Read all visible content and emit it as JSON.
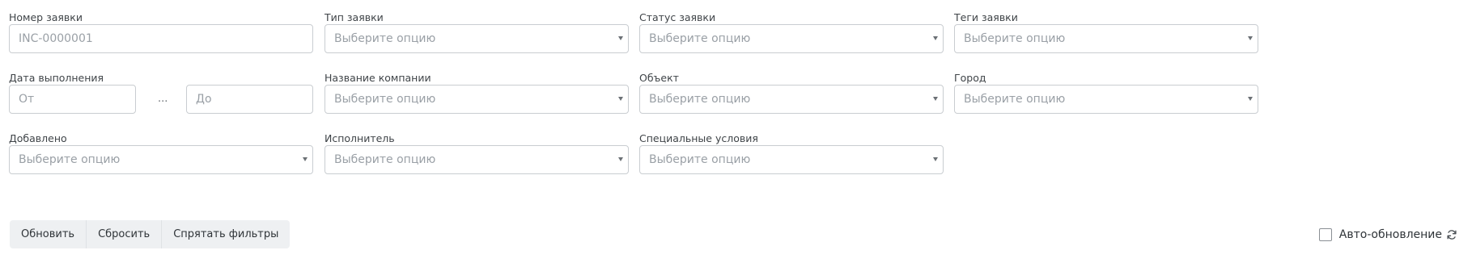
{
  "filters": {
    "request_number": {
      "label": "Номер заявки",
      "placeholder": "INC-0000001"
    },
    "request_type": {
      "label": "Тип заявки",
      "placeholder": "Выберите опцию"
    },
    "request_status": {
      "label": "Статус заявки",
      "placeholder": "Выберите опцию"
    },
    "request_tags": {
      "label": "Теги заявки",
      "placeholder": "Выберите опцию"
    },
    "completion_date": {
      "label": "Дата выполнения",
      "from_placeholder": "От",
      "separator": "...",
      "to_placeholder": "До"
    },
    "company_name": {
      "label": "Название компании",
      "placeholder": "Выберите опцию"
    },
    "object": {
      "label": "Объект",
      "placeholder": "Выберите опцию"
    },
    "city": {
      "label": "Город",
      "placeholder": "Выберите опцию"
    },
    "added": {
      "label": "Добавлено",
      "placeholder": "Выберите опцию"
    },
    "executor": {
      "label": "Исполнитель",
      "placeholder": "Выберите опцию"
    },
    "special_conditions": {
      "label": "Специальные условия",
      "placeholder": "Выберите опцию"
    }
  },
  "actions": {
    "refresh": "Обновить",
    "reset": "Сбросить",
    "hide_filters": "Спрятать фильтры"
  },
  "auto_refresh": {
    "label": "Авто-обновление",
    "checked": false,
    "icon": "refresh-icon"
  }
}
